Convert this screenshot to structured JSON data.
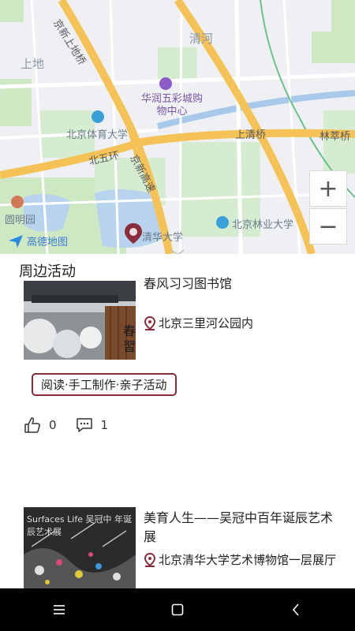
{
  "map": {
    "labels": {
      "qinghe": "清河",
      "shangdi": "上地",
      "jingxin_upper_road": "京新上地桥",
      "huarun_mall": "华润五彩城购物中心",
      "bj_sport_univ": "北京体育大学",
      "shangqing_bridge": "上清桥",
      "lincui_bridge": "林萃桥",
      "north_5th_ring": "北五环",
      "jingxin_highway": "京新高速",
      "yuanmingyuan": "圆明园",
      "tsinghua": "清华大学",
      "bj_forestry_univ": "北京林业大学",
      "lin": "林"
    },
    "zoom_in": "+",
    "zoom_out": "−",
    "logo_text": "高德地图"
  },
  "section": {
    "title": "周边活动"
  },
  "activities": [
    {
      "title": "春风习习图书馆",
      "location": "北京三里河公园内",
      "tag": "阅读·手工制作·亲子活动",
      "thumb_text": "春習",
      "likes": "0",
      "comments": "1"
    },
    {
      "title": "美育人生——吴冠中百年诞辰艺术展",
      "location": "北京清华大学艺术博物馆一层展厅",
      "thumb_text": "Surfaces Life 吴冠中 年诞辰艺术展"
    }
  ],
  "colors": {
    "accent": "#8a2c3c",
    "highway": "#f4c257",
    "navbar": "#000000"
  }
}
